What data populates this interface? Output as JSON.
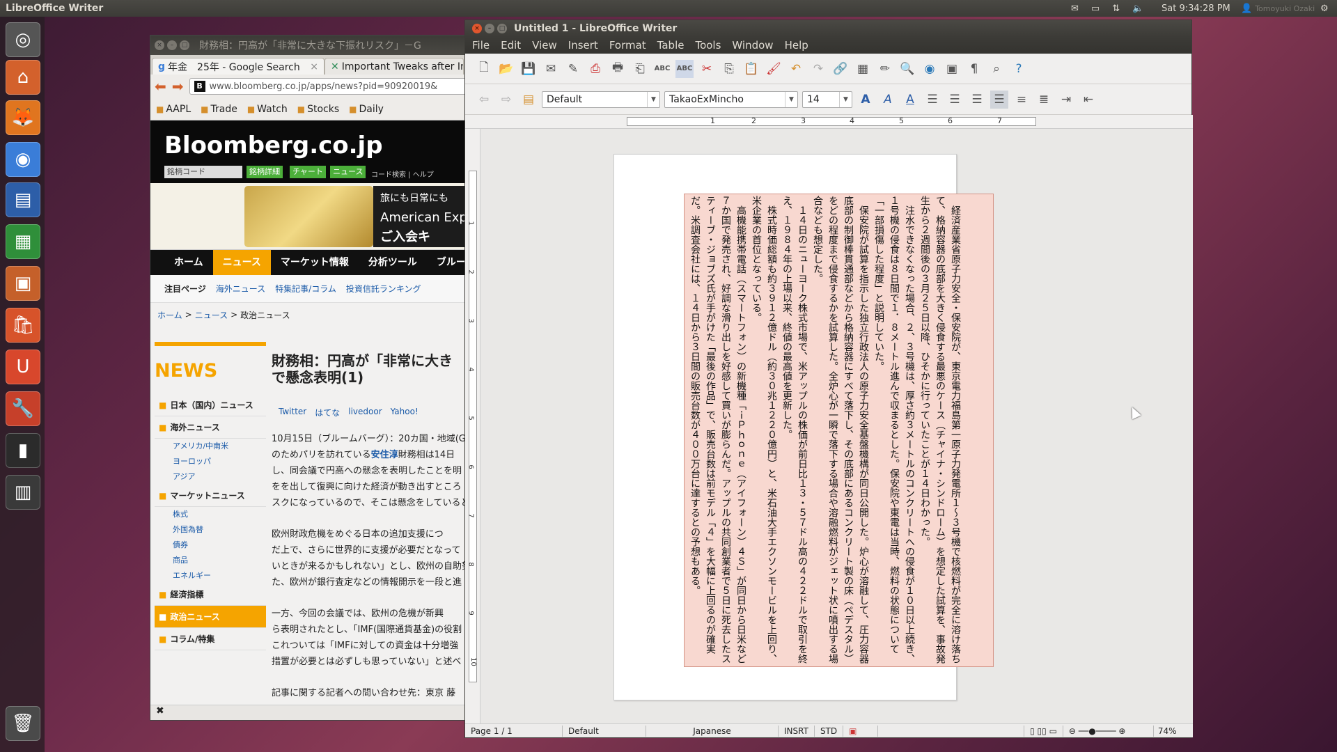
{
  "top_panel": {
    "app_name": "LibreOffice Writer",
    "clock": "Sat 9:34:28 PM",
    "user_name": "Tomoyuki Ozaki"
  },
  "launcher": {
    "items": [
      "dash-icon",
      "files-icon",
      "firefox-icon",
      "chrome-icon",
      "writer-icon",
      "calc-icon",
      "impress-icon",
      "software-center-icon",
      "ubuntu-one-icon",
      "system-settings-icon",
      "terminal-icon",
      "workspace-switcher-icon",
      "trash-icon"
    ]
  },
  "browser": {
    "title": "財務相：円高が「非常に大きな下振れリスク」－G",
    "tabs": [
      "年金　25年 - Google Search",
      "Important Tweaks after In"
    ],
    "url": "www.bloomberg.co.jp/apps/news?pid=90920019&",
    "bookmarks": [
      "AAPL",
      "Trade",
      "Watch",
      "Stocks",
      "Daily"
    ],
    "site": {
      "logo": "Bloomberg.co.jp",
      "code_placeholder": "銘柄コード",
      "header_buttons": [
        "銘柄詳細",
        "チャート",
        "ニュース"
      ],
      "header_links": "コード検索 | ヘルプ",
      "ad_line1": "旅にも日常にも",
      "ad_line2": "American Exp",
      "ad_line3": "ご入会キ",
      "nav": [
        "ホーム",
        "ニュース",
        "マーケット情報",
        "分析ツール",
        "ブルー"
      ],
      "subnav_title": "注目ページ",
      "subnav": [
        "海外ニュース",
        "特集記事/コラム",
        "投資信託ランキング"
      ],
      "breadcrumb": [
        "ホーム",
        "ニュース",
        "政治ニュース"
      ],
      "news_heading": "NEWS",
      "categories": [
        {
          "label": "日本（国内）ニュース",
          "subs": []
        },
        {
          "label": "海外ニュース",
          "subs": [
            "アメリカ/中南米",
            "ヨーロッパ",
            "アジア"
          ]
        },
        {
          "label": "マーケットニュース",
          "subs": [
            "株式",
            "外国為替",
            "債券",
            "商品",
            "エネルギー"
          ]
        },
        {
          "label": "経済指標",
          "subs": []
        },
        {
          "label": "政治ニュース",
          "subs": []
        },
        {
          "label": "コラム/特集",
          "subs": []
        }
      ],
      "article_title_1": "財務相：円高が「非常に大き",
      "article_title_2": "で懸念表明(1)",
      "share": [
        "Twitter",
        "はてな",
        "livedoor",
        "Yahoo!"
      ],
      "p1_l1": "10月15日（ブルームバーグ）：20カ国・地域(G",
      "p1_l2a": "のためパリを訪れている",
      "p1_l2_hl": "安住淳",
      "p1_l2b": "財務相は14日",
      "p1_l3": "し、同会議で円高への懸念を表明したことを明",
      "p1_l4": "をを出して復興に向けた経済が動き出すところ",
      "p1_l5": "スクになっているので、そこは懸念をしていると",
      "p2_l1": "欧州財政危機をめぐる日本の追加支援につ",
      "p2_l2": "だ上で、さらに世界的に支援が必要だとなって",
      "p2_l3": "いときが来るかもしれない」とし、欧州の自助努",
      "p2_l4": "た、欧州が銀行査定などの情報開示を一段と進",
      "p3_l1": "一方、今回の会議では、欧州の危機が新興",
      "p3_l2": "ら表明されたとし、「IMF(国際通貨基金)の役割",
      "p3_l3": "これついては「IMFに対しての資金は十分増強",
      "p3_l4": "措置が必要とは必ずしも思っていない」と述べ",
      "p4_l1": "記事に関する記者への問い合わせ先：東京 藤"
    }
  },
  "writer": {
    "title": "Untitled 1 - LibreOffice Writer",
    "menu": [
      "File",
      "Edit",
      "View",
      "Insert",
      "Format",
      "Table",
      "Tools",
      "Window",
      "Help"
    ],
    "style": "Default",
    "font": "TakaoExMincho",
    "size": "14",
    "ruler_numbers": [
      "1",
      "2",
      "3",
      "4",
      "5",
      "6",
      "7"
    ],
    "vruler_numbers": [
      "1",
      "2",
      "3",
      "4",
      "5",
      "6",
      "7",
      "8",
      "9",
      "10"
    ],
    "paragraphs": [
      "経済産業省原子力安全・保安院が、東京電力福島第一原子力発電所１〜３号機で核燃料が完全に溶け落ちて、格納容器の底部を大きく侵食する最悪のケース（チャイナ・シンドローム）を想定した試算を、事故発生から２週間後の３月２５日以降、ひそかに行っていたことが１４日わかった。",
      "注水できなくなった場合、２、３号機は、厚さ約３メートルのコンクリートへの侵食が１０日以上続き、１号機の侵食は８日間で１．８メートル進んで収まるとした。保安院や東電は当時、燃料の状態について「一部損傷した程度」と説明していた。",
      "保安院が試算を指示した独立行政法人の原子力安全基盤機構が同日公開した。炉心が溶融して、圧力容器底部の制御棒貫通部などから格納容器にすべて落下し、その底部にあるコンクリート製の床（ペデスタル）をどの程度まで侵食するかを試算した。全炉心が一瞬で落下する場合や溶融燃料がジェット状に噴出する場合なども想定した。",
      "１４日のニューヨーク株式市場で、米アップルの株価が前日比１３・５７ドル高の４２２ドルで取引を終え、１９８４年の上場以来、終値の最高値を更新した。",
      "株式時価総額も約３９１２億ドル（約３０兆１２２０億円）と、米石油大手エクソンモービルを上回り、米企業の首位となっている。",
      "高機能携帯電話（スマートフォン）の新機種「ｉＰｈｏｎｅ（アイフォーン）４Ｓ」が同日から日米など７か国で発売され、好調な滑り出しを好感して買いが膨らんだ。アップルの共同創業者で５日に死去したスティーブ・ジョブズ氏が手がけた「最後の作品」で、販売台数は前モデル「４」を大幅に上回るのが確実だ。米調査会社には、１４日から３日間の販売台数が４００万台に達するとの予想もある。"
    ],
    "status": {
      "page": "Page 1 / 1",
      "style": "Default",
      "language": "Japanese",
      "insert_mode": "INSRT",
      "selection_mode": "STD",
      "zoom": "74%"
    }
  }
}
